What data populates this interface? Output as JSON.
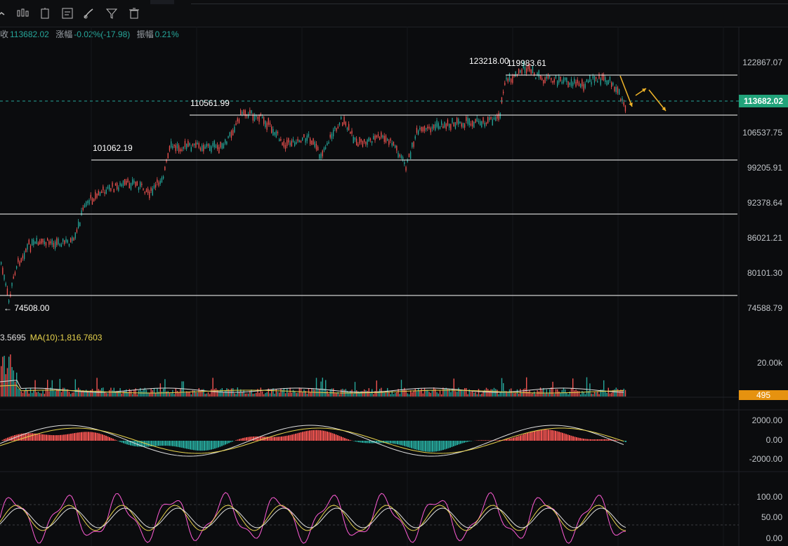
{
  "toolbar": {
    "icons": [
      "line-tool-icon",
      "candles-icon",
      "indicator-icon",
      "note-icon",
      "brush-icon",
      "filter-icon",
      "trash-icon"
    ]
  },
  "info": {
    "prefix": "收",
    "close": "113682.02",
    "change_label": "涨幅",
    "change": "-0.02%(-17.98)",
    "amplitude_label": "振幅",
    "amplitude": "0.21%"
  },
  "price_axis": [
    "122867.07",
    "113682.02",
    "106537.75",
    "99205.91",
    "92378.64",
    "86021.21",
    "80101.30",
    "74588.79"
  ],
  "current_price": "113682.02",
  "levels": {
    "high_a": "123218.00",
    "high_b": "119983.61",
    "l1": "110561.99",
    "l2": "101062.19",
    "low": "← 74508.00"
  },
  "volume": {
    "ma5_partial": "3.5695",
    "ma10": "MA(10):1,816.7603",
    "axis": "20.00k",
    "tag": "495"
  },
  "macd_axis": [
    "2000.00",
    "0.00",
    "-2000.00"
  ],
  "kdj_axis": [
    "100.00",
    "50.00",
    "0.00"
  ],
  "colors": {
    "up": "#26a69a",
    "down": "#ef5350",
    "ma1": "#e8d44d",
    "ma2": "#e0e0e0",
    "arrow": "#f0b429",
    "kline": "#ff5cd6"
  }
}
